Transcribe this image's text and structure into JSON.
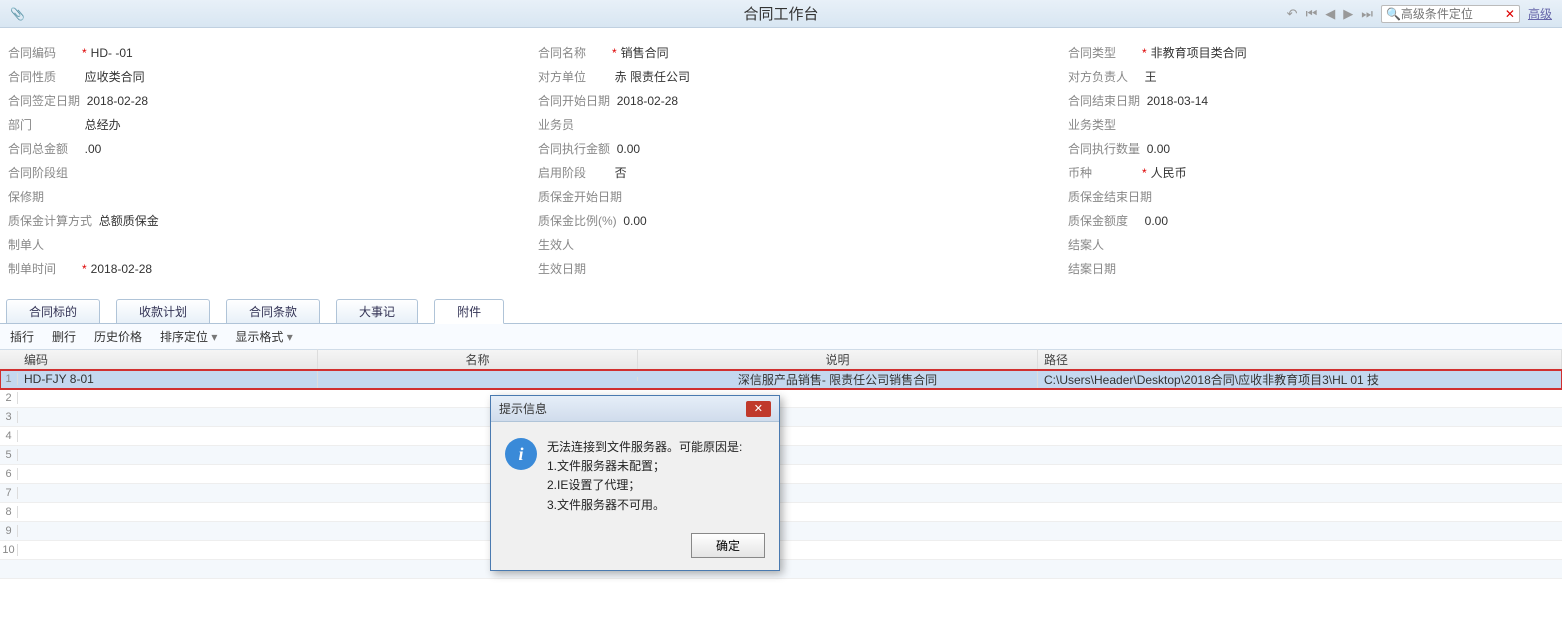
{
  "header": {
    "title": "合同工作台",
    "search_placeholder": "高级条件定位",
    "adv_label": "高级"
  },
  "form": {
    "r1": {
      "code_l": "合同编码",
      "code_v": "HD-                      -01",
      "name_l": "合同名称",
      "name_v": "销售合同",
      "type_l": "合同类型",
      "type_v": "非教育项目类合同"
    },
    "r2": {
      "nature_l": "合同性质",
      "nature_v": "应收类合同",
      "party_l": "对方单位",
      "party_v": "赤                  限责任公司",
      "resp_l": "对方负责人",
      "resp_v": "王"
    },
    "r3": {
      "sign_l": "合同签定日期",
      "sign_v": "2018-02-28",
      "start_l": "合同开始日期",
      "start_v": "2018-02-28",
      "end_l": "合同结束日期",
      "end_v": "2018-03-14"
    },
    "r4": {
      "dept_l": "部门",
      "dept_v": "总经办",
      "sales_l": "业务员",
      "sales_v": "",
      "btype_l": "业务类型",
      "btype_v": ""
    },
    "r5": {
      "total_l": "合同总金额",
      "total_v": "           .00",
      "exec_l": "合同执行金额",
      "exec_v": "0.00",
      "qty_l": "合同执行数量",
      "qty_v": "0.00"
    },
    "r6": {
      "pg_l": "合同阶段组",
      "pg_v": "",
      "sp_l": "启用阶段",
      "sp_v": "否",
      "cur_l": "币种",
      "cur_v": "人民币"
    },
    "r7": {
      "war_l": "保修期",
      "war_v": "",
      "qstart_l": "质保金开始日期",
      "qstart_v": "",
      "qend_l": "质保金结束日期",
      "qend_v": ""
    },
    "r8": {
      "qcalc_l": "质保金计算方式",
      "qcalc_v": "总额质保金",
      "qrate_l": "质保金比例(%)",
      "qrate_v": "0.00",
      "qamt_l": "质保金额度",
      "qamt_v": "0.00"
    },
    "r9": {
      "maker_l": "制单人",
      "maker_v": "",
      "eff_l": "生效人",
      "eff_v": "",
      "close_l": "结案人",
      "close_v": ""
    },
    "r10": {
      "mtime_l": "制单时间",
      "mtime_v": "2018-02-28",
      "effd_l": "生效日期",
      "effd_v": "",
      "closed_l": "结案日期",
      "closed_v": ""
    }
  },
  "tabs": {
    "t1": "合同标的",
    "t2": "收款计划",
    "t3": "合同条款",
    "t4": "大事记",
    "t5": "附件"
  },
  "toolbar": {
    "ins": "插行",
    "del": "删行",
    "hist": "历史价格",
    "sort": "排序定位",
    "disp": "显示格式"
  },
  "grid": {
    "h1": "编码",
    "h2": "名称",
    "h3": "说明",
    "h4": "路径",
    "row1": {
      "code": "HD-FJY               8-01",
      "name": "",
      "desc": "深信服产品销售-                    限责任公司销售合同",
      "path": "C:\\Users\\Header\\Desktop\\2018合同\\应收非教育项目3\\HL                           01             技"
    }
  },
  "dialog": {
    "title": "提示信息",
    "line1": "无法连接到文件服务器。可能原因是:",
    "line2": "1.文件服务器未配置；",
    "line3": "2.IE设置了代理；",
    "line4": "3.文件服务器不可用。",
    "ok": "确定"
  }
}
